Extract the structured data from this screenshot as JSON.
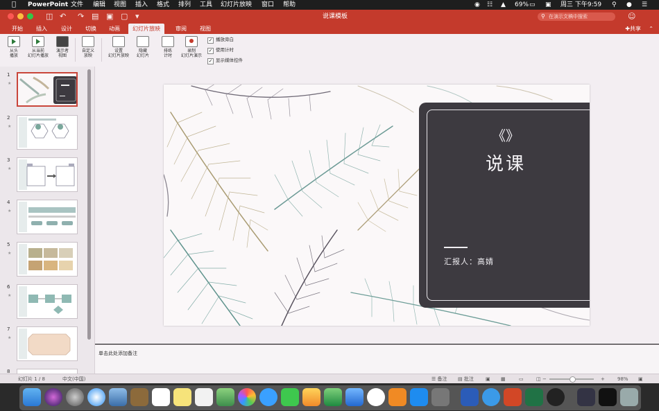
{
  "menubar": {
    "app": "PowerPoint",
    "items": [
      "文件",
      "编辑",
      "视图",
      "插入",
      "格式",
      "排列",
      "工具",
      "幻灯片放映",
      "窗口",
      "帮助"
    ],
    "battery": "69%",
    "clock": "周三 下午9:59"
  },
  "window": {
    "title": "说课模板",
    "search_placeholder": "在演示文稿中搜索",
    "share": "共享"
  },
  "ribbon_tabs": [
    "开始",
    "插入",
    "设计",
    "切换",
    "动画",
    "幻灯片放映",
    "审阅",
    "视图"
  ],
  "active_tab": "幻灯片放映",
  "ribbon": {
    "buttons": [
      {
        "label": "从头\n播放",
        "icon": "play-from-start-icon"
      },
      {
        "label": "从当前\n幻灯片播放",
        "icon": "play-current-icon"
      },
      {
        "label": "演示者\n视图",
        "icon": "presenter-view-icon"
      },
      {
        "label": "自定义\n放映",
        "icon": "custom-show-icon"
      },
      {
        "label": "设置\n幻灯片放映",
        "icon": "setup-show-icon"
      },
      {
        "label": "隐藏\n幻灯片",
        "icon": "hide-slide-icon"
      },
      {
        "label": "排练\n计时",
        "icon": "rehearse-timings-icon"
      },
      {
        "label": "录制\n幻灯片演示",
        "icon": "record-show-icon"
      }
    ],
    "checkboxes": [
      {
        "label": "播放旁白",
        "checked": true
      },
      {
        "label": "使用计时",
        "checked": true
      },
      {
        "label": "显示媒体控件",
        "checked": true
      }
    ]
  },
  "thumbnails": [
    {
      "number": "1",
      "selected": true
    },
    {
      "number": "2",
      "selected": false
    },
    {
      "number": "3",
      "selected": false
    },
    {
      "number": "4",
      "selected": false
    },
    {
      "number": "5",
      "selected": false
    },
    {
      "number": "6",
      "selected": false
    },
    {
      "number": "7",
      "selected": false
    },
    {
      "number": "8",
      "selected": false
    }
  ],
  "slide": {
    "brackets": "《》",
    "title": "说课",
    "reporter": "汇报人：高婧"
  },
  "notes_placeholder": "单击此处添加备注",
  "statusbar": {
    "slide_count": "幻灯片 1 / 8",
    "language": "中文(中国)",
    "notes_btn": "备注",
    "comments_btn": "批注",
    "zoom": "98%"
  },
  "colors": {
    "brand": "#c43a2c",
    "card": "#3d3a40"
  }
}
